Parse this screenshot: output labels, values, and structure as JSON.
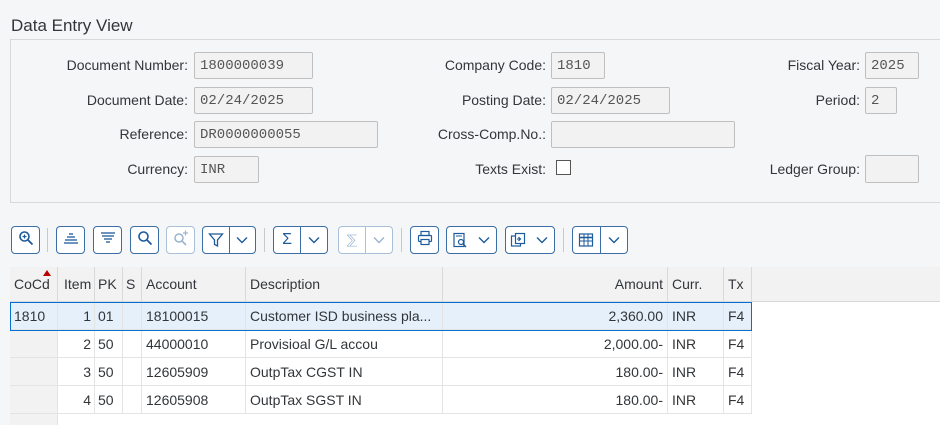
{
  "title": "Data Entry View",
  "header": {
    "document_number": {
      "label": "Document Number:",
      "value": "1800000039"
    },
    "company_code": {
      "label": "Company Code:",
      "value": "1810"
    },
    "fiscal_year": {
      "label": "Fiscal Year:",
      "value": "2025"
    },
    "document_date": {
      "label": "Document Date:",
      "value": "02/24/2025"
    },
    "posting_date": {
      "label": "Posting Date:",
      "value": "02/24/2025"
    },
    "period": {
      "label": "Period:",
      "value": "2"
    },
    "reference": {
      "label": "Reference:",
      "value": "DR0000000055"
    },
    "cross_comp": {
      "label": "Cross-Comp.No.:",
      "value": ""
    },
    "currency": {
      "label": "Currency:",
      "value": "INR"
    },
    "texts_exist": {
      "label": "Texts Exist:",
      "checked": false
    },
    "ledger_group": {
      "label": "Ledger Group:",
      "value": ""
    }
  },
  "toolbar": {
    "sum_symbol": "Σ",
    "subtotal_symbol": "⅀"
  },
  "table": {
    "columns": [
      "CoCd",
      "Item",
      "PK",
      "S",
      "Account",
      "Description",
      "Amount",
      "Curr.",
      "Tx"
    ],
    "rows": [
      {
        "cocd": "1810",
        "item": "1",
        "pk": "01",
        "s": "",
        "account": "18100015",
        "description": "Customer ISD business pla...",
        "amount": "2,360.00",
        "curr": "INR",
        "tx": "F4"
      },
      {
        "cocd": "",
        "item": "2",
        "pk": "50",
        "s": "",
        "account": "44000010",
        "description": "Provisioal G/L accou",
        "amount": "2,000.00-",
        "curr": "INR",
        "tx": "F4"
      },
      {
        "cocd": "",
        "item": "3",
        "pk": "50",
        "s": "",
        "account": "12605909",
        "description": "OutpTax CGST IN",
        "amount": "180.00-",
        "curr": "INR",
        "tx": "F4"
      },
      {
        "cocd": "",
        "item": "4",
        "pk": "50",
        "s": "",
        "account": "12605908",
        "description": "OutpTax SGST IN",
        "amount": "180.00-",
        "curr": "INR",
        "tx": "F4"
      }
    ]
  }
}
